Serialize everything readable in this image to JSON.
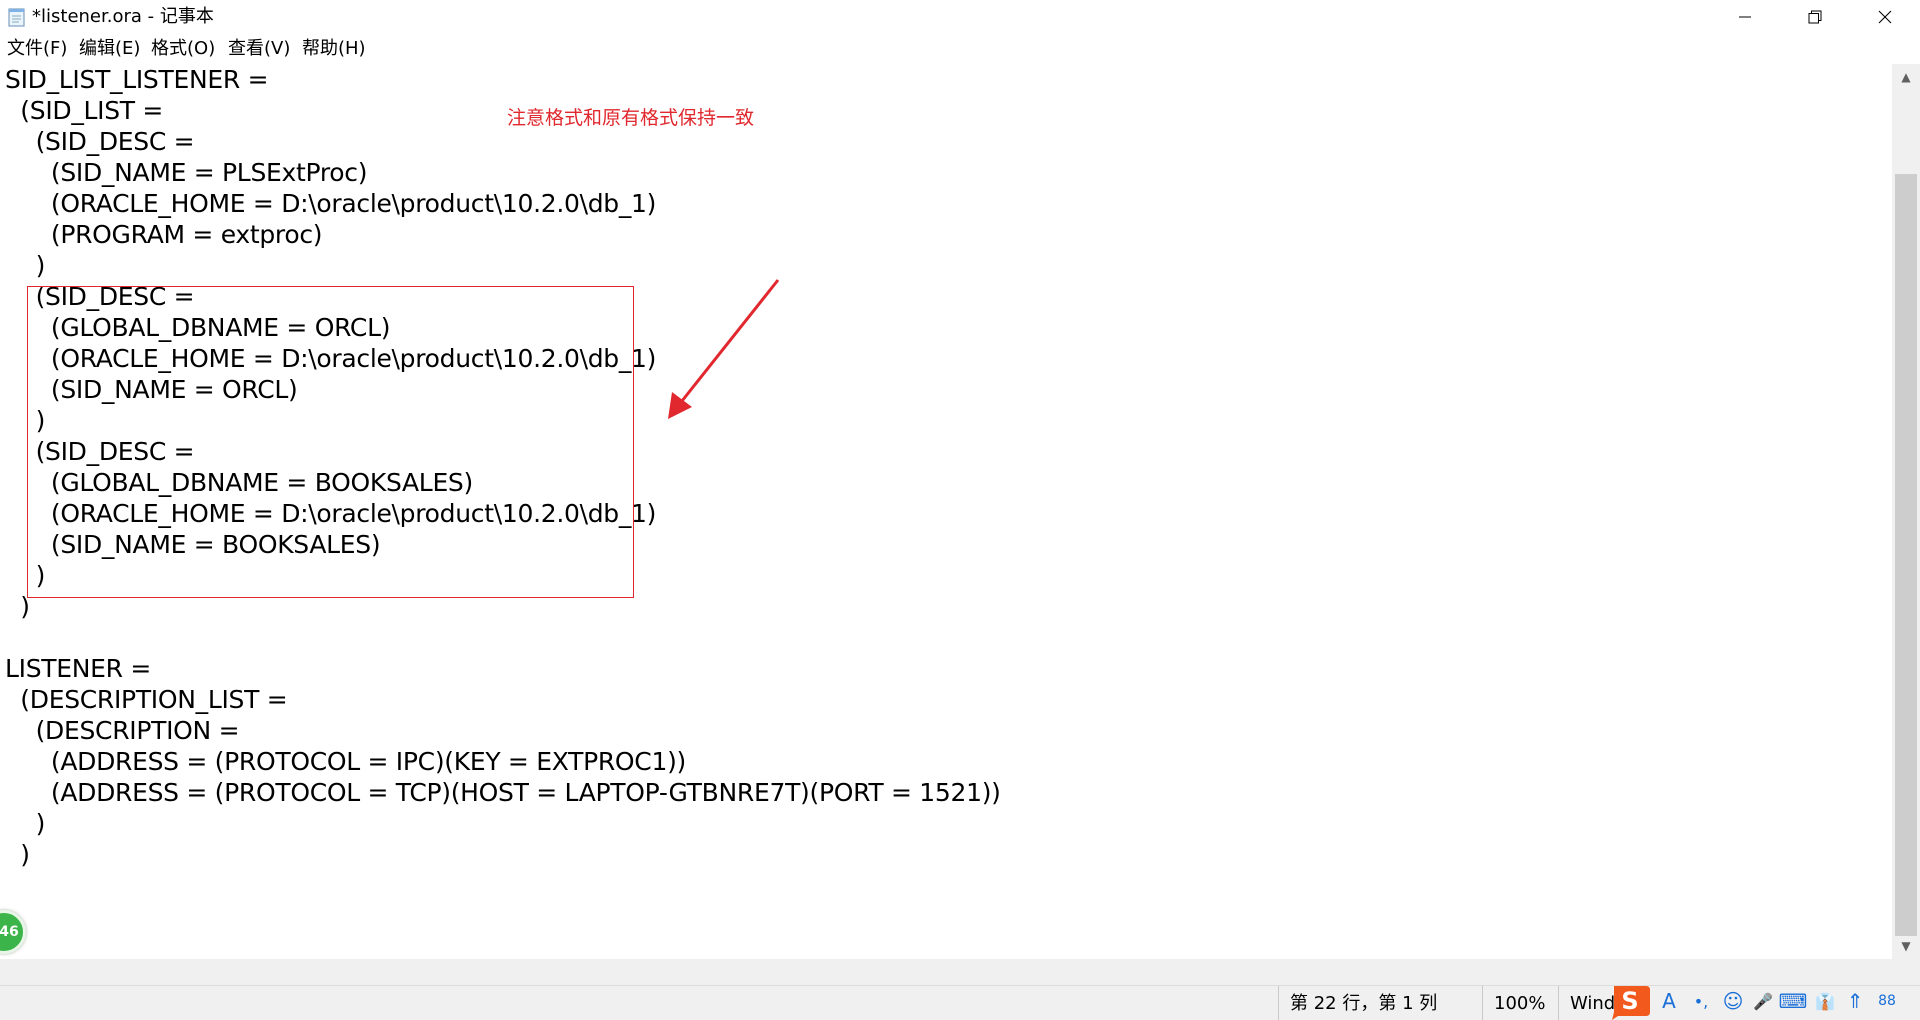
{
  "window": {
    "title": "*listener.ora - 记事本",
    "minimize_icon": "minimize-icon",
    "restore_icon": "restore-icon",
    "close_icon": "close-icon"
  },
  "menu": {
    "items": [
      "文件(F)",
      "编辑(E)",
      "格式(O)",
      "查看(V)",
      "帮助(H)"
    ]
  },
  "editor": {
    "lines": [
      "SID_LIST_LISTENER =",
      "  (SID_LIST =",
      "    (SID_DESC =",
      "      (SID_NAME = PLSExtProc)",
      "      (ORACLE_HOME = D:\\oracle\\product\\10.2.0\\db_1)",
      "      (PROGRAM = extproc)",
      "    )",
      "    (SID_DESC =",
      "      (GLOBAL_DBNAME = ORCL)",
      "      (ORACLE_HOME = D:\\oracle\\product\\10.2.0\\db_1)",
      "      (SID_NAME = ORCL)",
      "    )",
      "    (SID_DESC =",
      "      (GLOBAL_DBNAME = BOOKSALES)",
      "      (ORACLE_HOME = D:\\oracle\\product\\10.2.0\\db_1)",
      "      (SID_NAME = BOOKSALES)",
      "    )",
      "  )",
      "",
      "LISTENER =",
      "  (DESCRIPTION_LIST =",
      "    (DESCRIPTION =",
      "      (ADDRESS = (PROTOCOL = IPC)(KEY = EXTPROC1))",
      "      (ADDRESS = (PROTOCOL = TCP)(HOST = LAPTOP-GTBNRE7T)(PORT = 1521))",
      "    )",
      "  )"
    ],
    "annotation": {
      "text": "注意格式和原有格式保持一致",
      "color": "#e0282e"
    }
  },
  "status": {
    "position": "第 22 行，第 1 列",
    "zoom": "100%",
    "line_ending": "Windo"
  },
  "ime": {
    "logo": "S",
    "icons": [
      "A",
      "•,",
      "☺",
      "🎤",
      "⌨",
      "👔",
      "⇑",
      "88"
    ]
  },
  "badge": {
    "text": "46"
  },
  "colors": {
    "accent_red": "#e0282e",
    "badge_green": "#3bb54a",
    "ime_orange": "#f25a1d"
  }
}
